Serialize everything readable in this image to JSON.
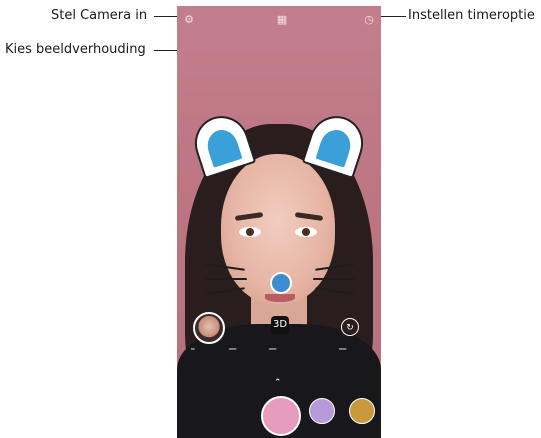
{
  "callouts": {
    "settings": "Stel Camera in",
    "aspect_ratio": "Kies beeldverhouding",
    "timer": "Instellen timeroptie"
  },
  "topbar": {
    "settings_icon": "gear-icon",
    "aspect_icon": "aspect-ratio-icon",
    "timer_icon": "timer-icon"
  },
  "controls": {
    "sticker_label": "3D",
    "switch_icon": "switch-camera-icon",
    "chevron_icon": "chevron-up-icon"
  },
  "colors": {
    "background": "#bd7582",
    "ear_inner": "#3b9fd8",
    "nose": "#3d8ed0",
    "shutter": "#e79bbd"
  }
}
